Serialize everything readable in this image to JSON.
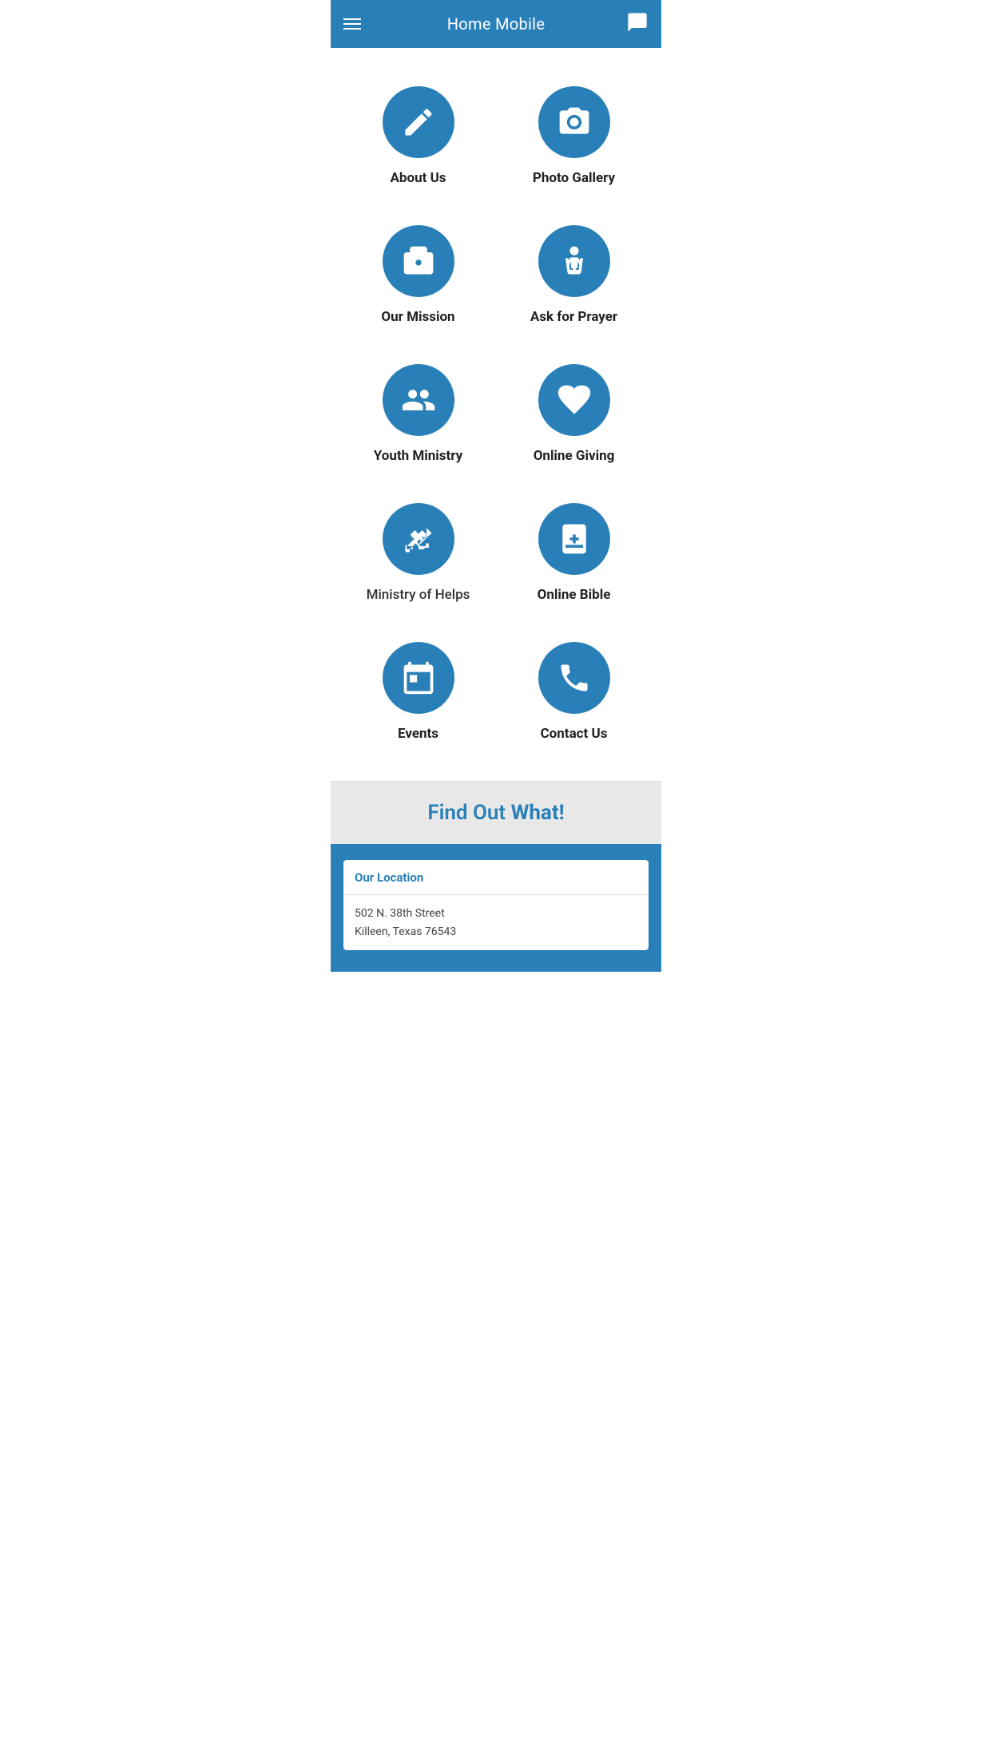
{
  "header": {
    "title": "Home Mobile"
  },
  "menu_items": [
    {
      "id": "about-us",
      "label": "About Us",
      "icon": "edit"
    },
    {
      "id": "photo-gallery",
      "label": "Photo Gallery",
      "icon": "camera"
    },
    {
      "id": "our-mission",
      "label": "Our Mission",
      "icon": "briefcase"
    },
    {
      "id": "ask-for-prayer",
      "label": "Ask for Prayer",
      "icon": "pray"
    },
    {
      "id": "youth-ministry",
      "label": "Youth Ministry",
      "icon": "people"
    },
    {
      "id": "online-giving",
      "label": "Online Giving",
      "icon": "hand-heart"
    },
    {
      "id": "ministry-of-helps",
      "label": "Ministry of Helps",
      "icon": "handshake",
      "light": true
    },
    {
      "id": "online-bible",
      "label": "Online Bible",
      "icon": "bible"
    },
    {
      "id": "events",
      "label": "Events",
      "icon": "calendar"
    },
    {
      "id": "contact-us",
      "label": "Contact Us",
      "icon": "phone"
    }
  ],
  "find_out": {
    "prefix": "Find Out ",
    "highlight": "What!"
  },
  "location": {
    "title": "Our Location",
    "address_line1": "502 N. 38th Street",
    "address_line2": "Killeen, Texas 76543"
  }
}
